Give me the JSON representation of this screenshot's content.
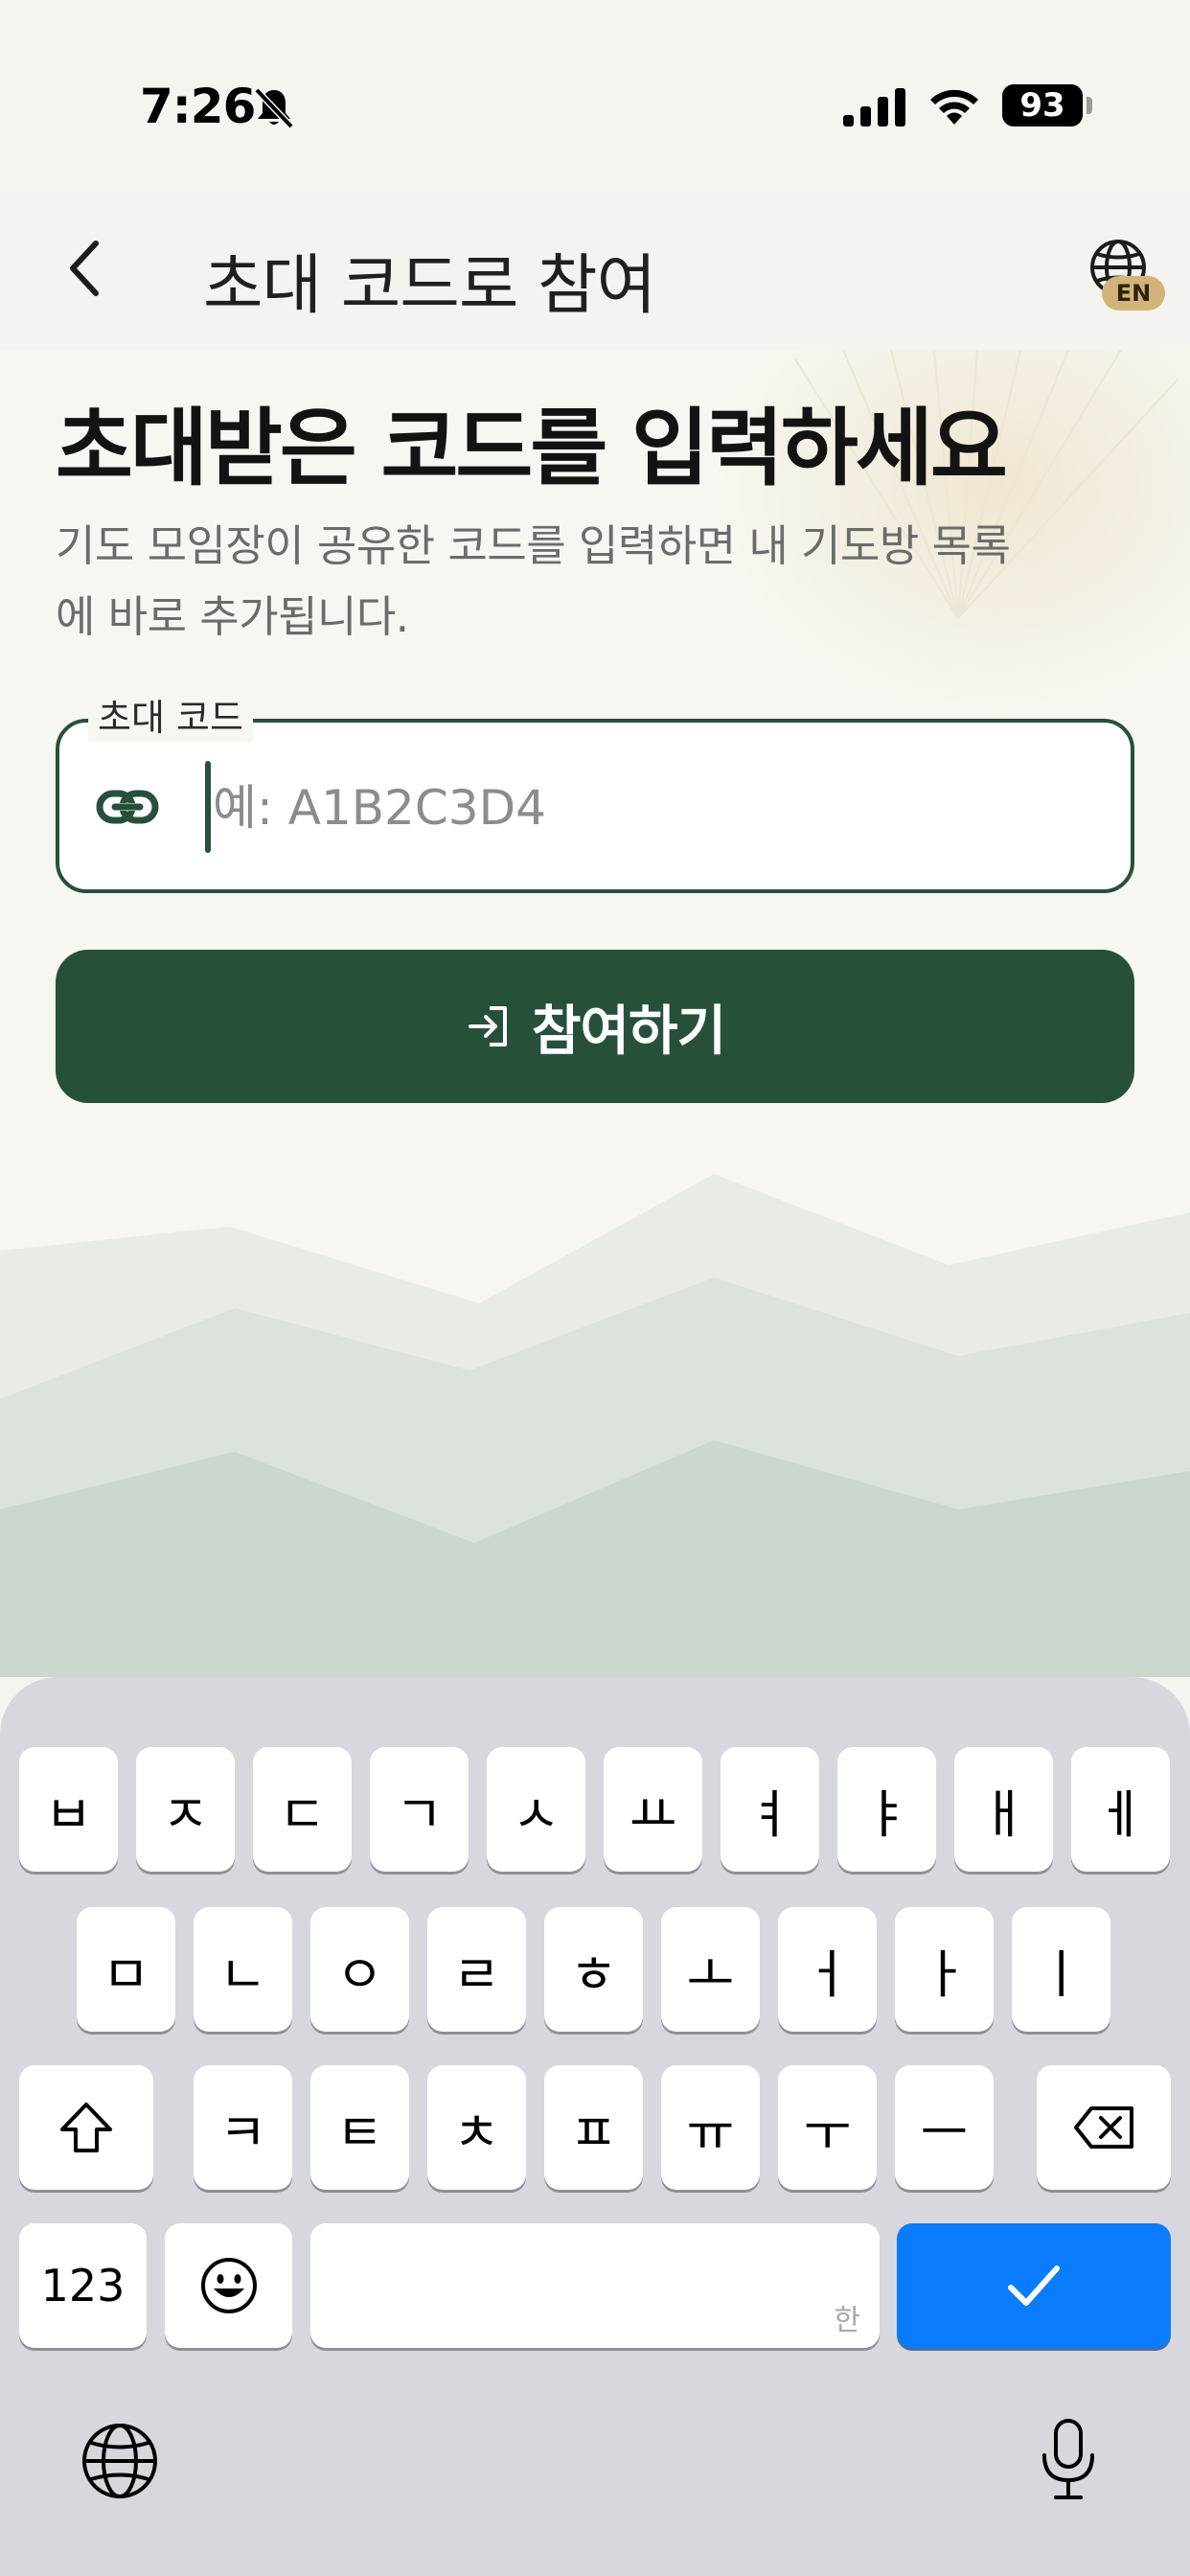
{
  "status_bar": {
    "time": "7:26",
    "battery": "93",
    "icons": [
      "bell-slash-icon",
      "signal-icon",
      "wifi-icon",
      "battery-icon"
    ]
  },
  "header": {
    "title": "초대 코드로 참여",
    "back_icon": "chevron-left-icon",
    "language_icon": "globe-icon",
    "language_badge": "EN"
  },
  "main": {
    "headline": "초대받은 코드를 입력하세요",
    "subtext_line1": "기도 모임장이 공유한 코드를 입력하면 내 기도방 목록",
    "subtext_line2": "에 바로 추가됩니다.",
    "code_field": {
      "label": "초대 코드",
      "placeholder": "예: A1B2C3D4",
      "value": "",
      "icon": "link-icon"
    },
    "join_button": {
      "label": "참여하기",
      "icon": "login-icon"
    }
  },
  "keyboard": {
    "row1": [
      "ㅂ",
      "ㅈ",
      "ㄷ",
      "ㄱ",
      "ㅅ",
      "ㅛ",
      "ㅕ",
      "ㅑ",
      "ㅐ",
      "ㅔ"
    ],
    "row2": [
      "ㅁ",
      "ㄴ",
      "ㅇ",
      "ㄹ",
      "ㅎ",
      "ㅗ",
      "ㅓ",
      "ㅏ",
      "ㅣ"
    ],
    "row3": [
      "ㅋ",
      "ㅌ",
      "ㅊ",
      "ㅍ",
      "ㅠ",
      "ㅜ",
      "ㅡ"
    ],
    "numbers_label": "123",
    "space_hint": "한",
    "icons": [
      "shift-icon",
      "backspace-icon",
      "emoji-icon",
      "checkmark-icon",
      "globe-icon",
      "microphone-icon"
    ]
  },
  "colors": {
    "primary": "#27503a",
    "keyboard_bg": "#d6d8de",
    "confirm_key": "#0a7cff",
    "language_badge": "#d2b47a"
  }
}
